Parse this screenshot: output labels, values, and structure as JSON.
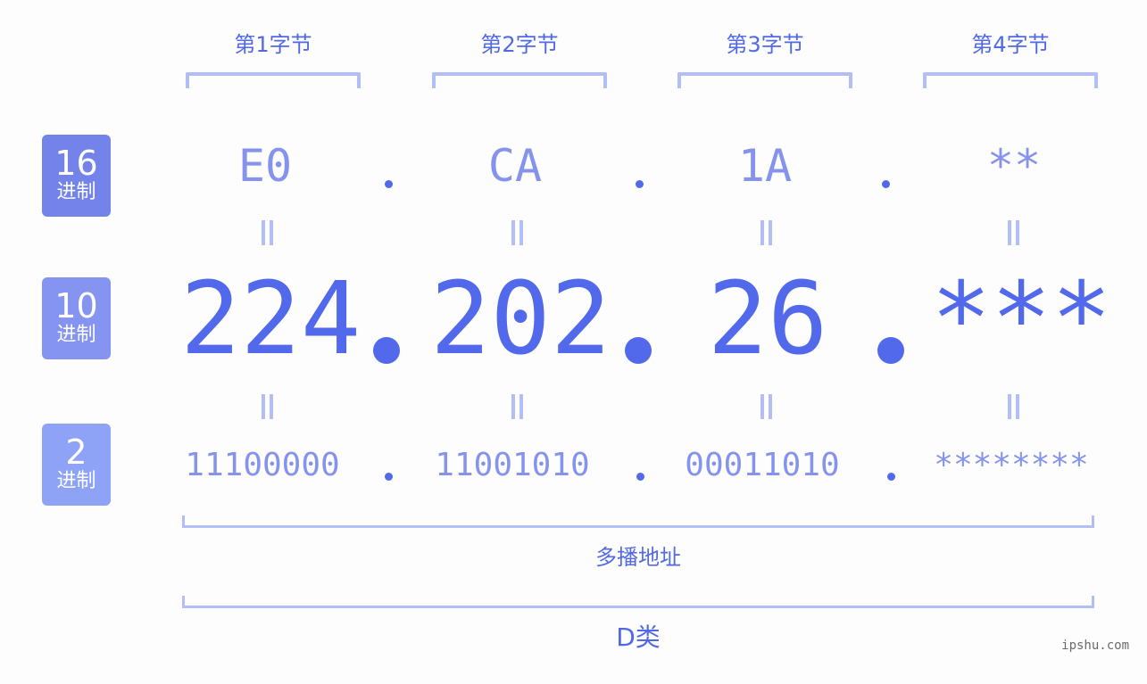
{
  "colors": {
    "primary": "#5169ea",
    "light": "#8593ec",
    "bracket": "#b3bdf6",
    "badge_hex": "#7383ea",
    "badge_dec": "#8594f0",
    "badge_bin": "#8ea3f6",
    "background": "#fcfdfc"
  },
  "bytes": [
    {
      "label": "第1字节",
      "hex": "E0",
      "dec": "224",
      "bin": "11100000"
    },
    {
      "label": "第2字节",
      "hex": "CA",
      "dec": "202",
      "bin": "11001010"
    },
    {
      "label": "第3字节",
      "hex": "1A",
      "dec": "26",
      "bin": "00011010"
    },
    {
      "label": "第4字节",
      "hex": "**",
      "dec": "***",
      "bin": "********"
    }
  ],
  "bases": {
    "hex": {
      "num": "16",
      "unit": "进制"
    },
    "dec": {
      "num": "10",
      "unit": "进制"
    },
    "bin": {
      "num": "2",
      "unit": "进制"
    }
  },
  "address_type": "多播地址",
  "address_class": "D类",
  "watermark": "ipshu.com"
}
